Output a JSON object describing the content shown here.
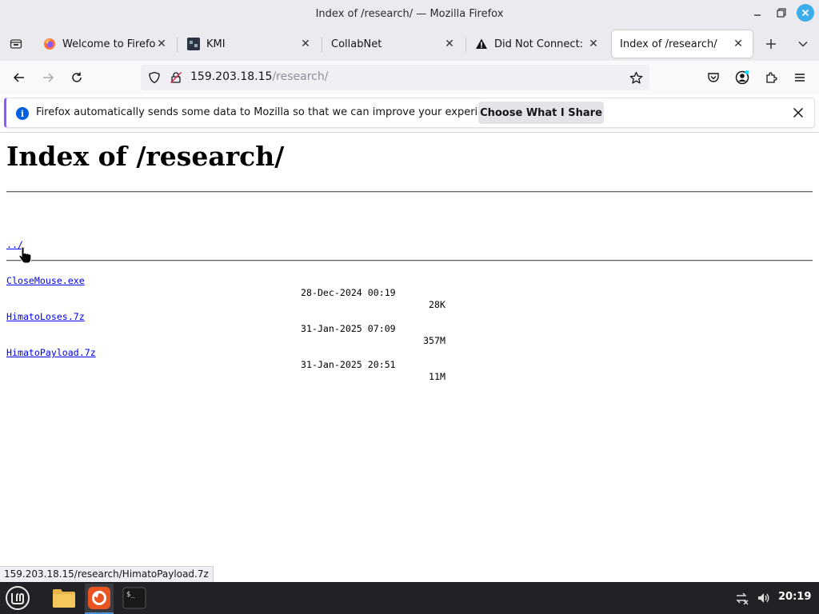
{
  "window": {
    "title": "Index of /research/ — Mozilla Firefox"
  },
  "tabs": [
    {
      "label": "Welcome to Firefox",
      "icon": "firefox-icon",
      "active": false
    },
    {
      "label": "KMI",
      "icon": "kmi-site-icon",
      "active": false
    },
    {
      "label": "CollabNet",
      "icon": "",
      "active": false
    },
    {
      "label": "Did Not Connect: Po",
      "icon": "warning-icon",
      "active": false
    },
    {
      "label": "Index of /research/",
      "icon": "",
      "active": true
    }
  ],
  "urlbar": {
    "host": "159.203.18.15",
    "path": "/research/"
  },
  "notification": {
    "message": "Firefox automatically sends some data to Mozilla so that we can improve your experience.",
    "button_label": "Choose What I Share"
  },
  "page": {
    "heading": "Index of /research/",
    "parent_link": "../",
    "entries": [
      {
        "name": "CloseMouse.exe",
        "date": "28-Dec-2024 00:19",
        "size": "28K"
      },
      {
        "name": "HimatoLoses.7z",
        "date": "31-Jan-2025 07:09",
        "size": "357M"
      },
      {
        "name": "HimatoPayload.7z",
        "date": "31-Jan-2025 20:51",
        "size": "11M"
      }
    ]
  },
  "status_text": "159.203.18.15/research/HimatoPayload.7z",
  "taskbar": {
    "clock": "20:19"
  },
  "colors": {
    "link": "#0000ee",
    "accent": "#9059ff",
    "info_blue": "#0060df"
  }
}
